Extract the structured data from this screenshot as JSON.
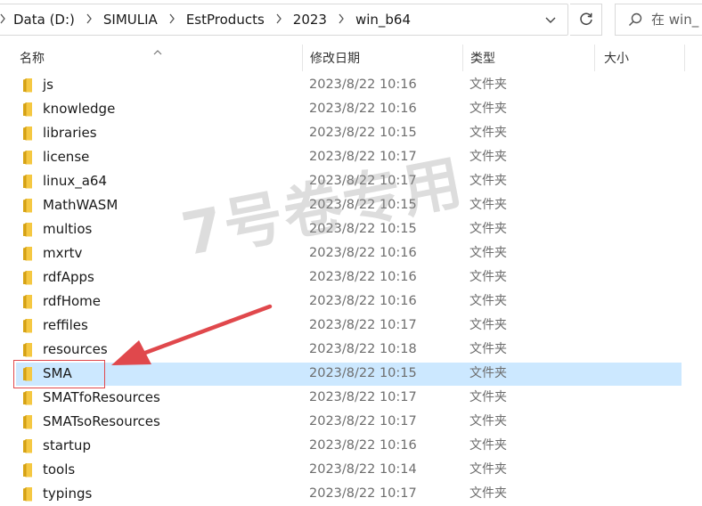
{
  "address_bar": {
    "breadcrumbs": [
      "Data (D:)",
      "SIMULIA",
      "EstProducts",
      "2023",
      "win_b64"
    ]
  },
  "search": {
    "placeholder": "在 win_"
  },
  "columns": {
    "name": "名称",
    "date": "修改日期",
    "type": "类型",
    "size": "大小"
  },
  "files": [
    {
      "name": "js",
      "date": "2023/8/22 10:16",
      "type": "文件夹"
    },
    {
      "name": "knowledge",
      "date": "2023/8/22 10:16",
      "type": "文件夹"
    },
    {
      "name": "libraries",
      "date": "2023/8/22 10:15",
      "type": "文件夹"
    },
    {
      "name": "license",
      "date": "2023/8/22 10:17",
      "type": "文件夹"
    },
    {
      "name": "linux_a64",
      "date": "2023/8/22 10:17",
      "type": "文件夹"
    },
    {
      "name": "MathWASM",
      "date": "2023/8/22 10:15",
      "type": "文件夹"
    },
    {
      "name": "multios",
      "date": "2023/8/22 10:15",
      "type": "文件夹"
    },
    {
      "name": "mxrtv",
      "date": "2023/8/22 10:16",
      "type": "文件夹"
    },
    {
      "name": "rdfApps",
      "date": "2023/8/22 10:16",
      "type": "文件夹"
    },
    {
      "name": "rdfHome",
      "date": "2023/8/22 10:16",
      "type": "文件夹"
    },
    {
      "name": "reffiles",
      "date": "2023/8/22 10:17",
      "type": "文件夹"
    },
    {
      "name": "resources",
      "date": "2023/8/22 10:18",
      "type": "文件夹"
    },
    {
      "name": "SMA",
      "date": "2023/8/22 10:15",
      "type": "文件夹",
      "selected": true
    },
    {
      "name": "SMATfoResources",
      "date": "2023/8/22 10:17",
      "type": "文件夹"
    },
    {
      "name": "SMATsoResources",
      "date": "2023/8/22 10:17",
      "type": "文件夹"
    },
    {
      "name": "startup",
      "date": "2023/8/22 10:16",
      "type": "文件夹"
    },
    {
      "name": "tools",
      "date": "2023/8/22 10:14",
      "type": "文件夹"
    },
    {
      "name": "typings",
      "date": "2023/8/22 10:17",
      "type": "文件夹"
    }
  ],
  "watermark": "7号卷专用",
  "colors": {
    "selection": "#cce8ff",
    "annotation_red": "#e0484c",
    "folder_yellow": "#f5c842"
  },
  "icons": {
    "folder": "folder-icon",
    "refresh": "refresh-icon",
    "search": "search-icon",
    "dropdown": "chevron-down-icon",
    "breadcrumb_separator": "chevron-right-icon",
    "sort": "sort-ascending-icon"
  }
}
